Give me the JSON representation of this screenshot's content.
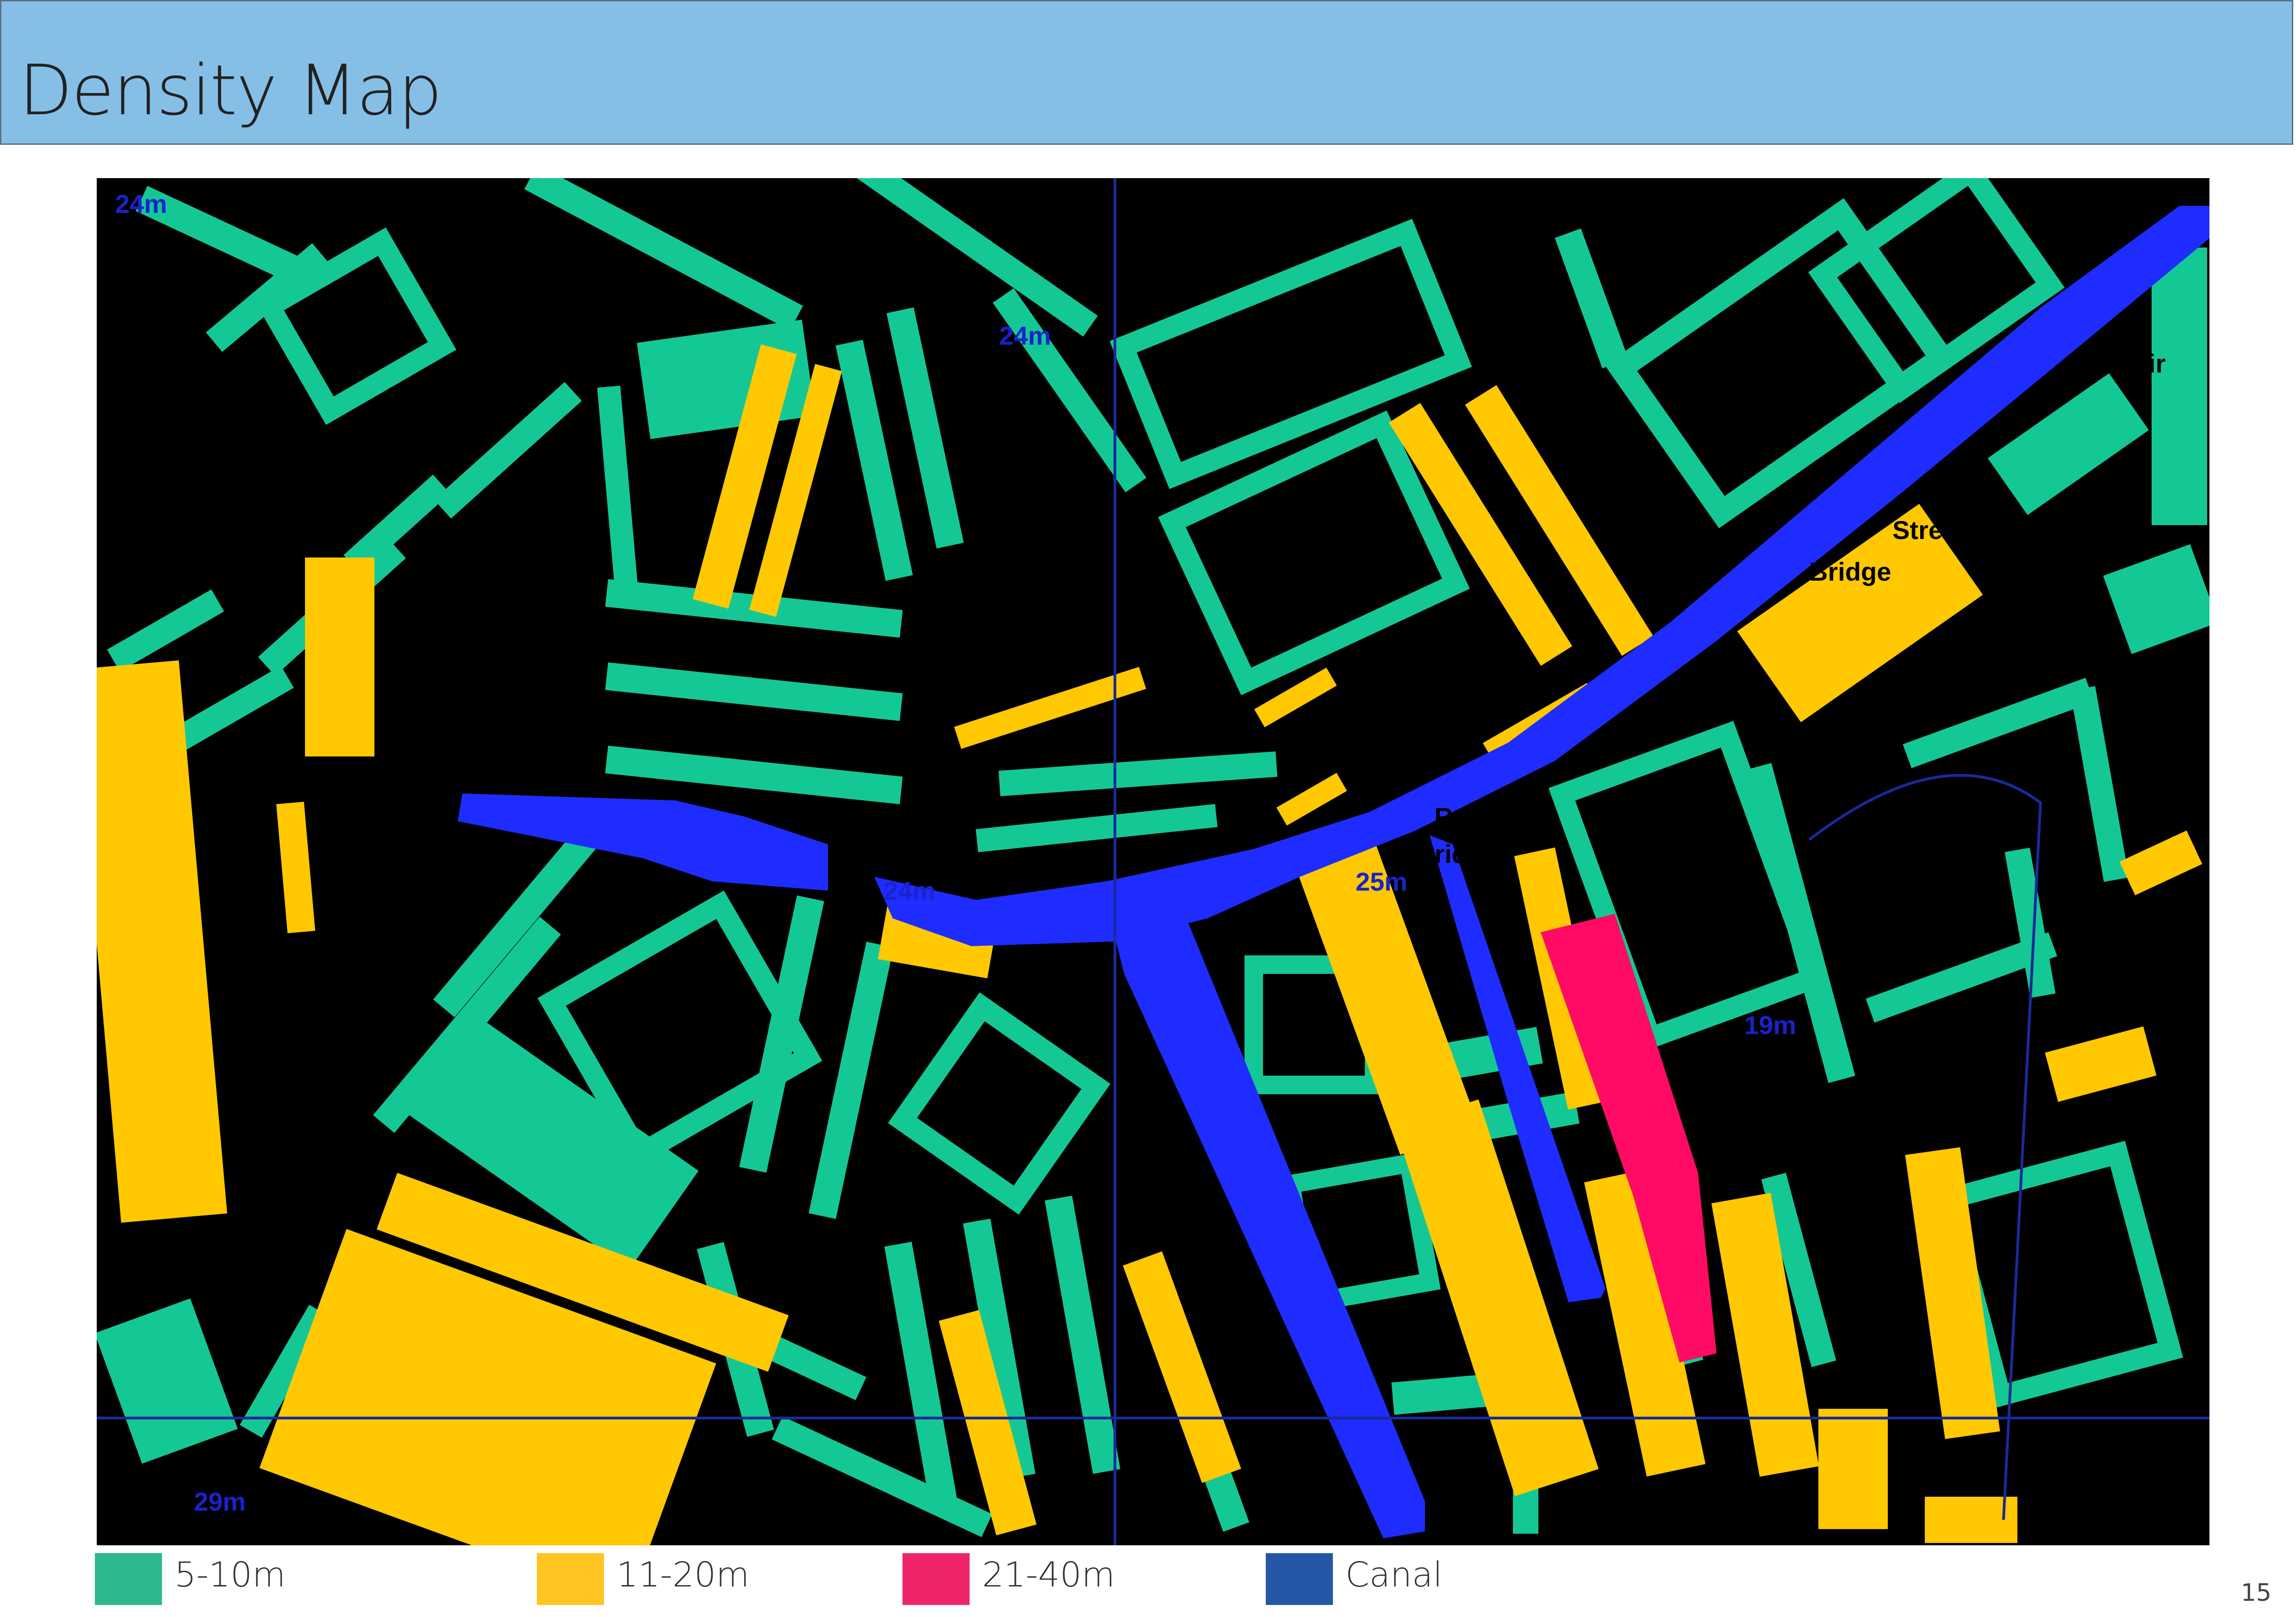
{
  "header": {
    "title": "Density Map"
  },
  "colors": {
    "low": "#14c896",
    "mid": "#ffc800",
    "high": "#ff0a64",
    "canal": "#1e2cff",
    "background": "#000000"
  },
  "map": {
    "labels": [
      "24m",
      "24m",
      "24m",
      "25m",
      "19m",
      "29m"
    ],
    "street_fragments": [
      "Street",
      "Bridge",
      "Rd",
      "Bridge",
      "Weir"
    ]
  },
  "legend": [
    {
      "label": "5-10m",
      "color": "#2eb88e"
    },
    {
      "label": "11-20m",
      "color": "#ffc420"
    },
    {
      "label": "21-40m",
      "color": "#f0246a"
    },
    {
      "label": "Canal",
      "color": "#2458a6"
    }
  ],
  "page": {
    "number": "15"
  }
}
